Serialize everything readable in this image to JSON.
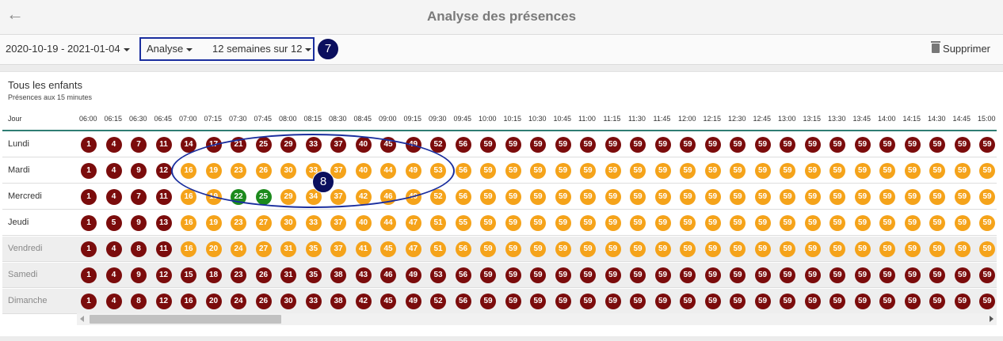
{
  "header": {
    "title": "Analyse des présences"
  },
  "toolbar": {
    "date_range": "2020-10-19 - 2021-01-04",
    "mode": "Analyse",
    "weeks": "12 semaines sur 12",
    "delete_label": "Supprimer"
  },
  "callouts": {
    "toolbar": "7",
    "grid": "8"
  },
  "panel": {
    "title": "Tous les enfants",
    "subtitle": "Présences aux 15 minutes"
  },
  "grid": {
    "first_column_header": "Jour",
    "times": [
      "06:00",
      "06:15",
      "06:30",
      "06:45",
      "07:00",
      "07:15",
      "07:30",
      "07:45",
      "08:00",
      "08:15",
      "08:30",
      "08:45",
      "09:00",
      "09:15",
      "09:30",
      "09:45",
      "10:00",
      "10:15",
      "10:30",
      "10:45",
      "11:00",
      "11:15",
      "11:30",
      "11:45",
      "12:00",
      "12:15",
      "12:30",
      "12:45",
      "13:00",
      "13:15",
      "13:30",
      "13:45",
      "14:00",
      "14:15",
      "14:30",
      "14:45",
      "15:00"
    ],
    "rows": [
      {
        "day": "Lundi",
        "shaded": false,
        "values": [
          1,
          4,
          7,
          11,
          14,
          17,
          21,
          25,
          29,
          33,
          37,
          40,
          45,
          49,
          52,
          56,
          59,
          59,
          59,
          59,
          59,
          59,
          59,
          59,
          59,
          59,
          59,
          59,
          59,
          59,
          59,
          59,
          59,
          59,
          59,
          59,
          59
        ],
        "colors": [
          "r",
          "r",
          "r",
          "r",
          "r",
          "r",
          "r",
          "r",
          "r",
          "r",
          "r",
          "r",
          "r",
          "r",
          "r",
          "r",
          "r",
          "r",
          "r",
          "r",
          "r",
          "r",
          "r",
          "r",
          "r",
          "r",
          "r",
          "r",
          "r",
          "r",
          "r",
          "r",
          "r",
          "r",
          "r",
          "r",
          "r"
        ]
      },
      {
        "day": "Mardi",
        "shaded": false,
        "values": [
          1,
          4,
          9,
          12,
          16,
          19,
          23,
          26,
          30,
          33,
          37,
          40,
          44,
          49,
          53,
          56,
          59,
          59,
          59,
          59,
          59,
          59,
          59,
          59,
          59,
          59,
          59,
          59,
          59,
          59,
          59,
          59,
          59,
          59,
          59,
          59,
          59
        ],
        "colors": [
          "r",
          "r",
          "r",
          "r",
          "o",
          "o",
          "o",
          "o",
          "o",
          "o",
          "o",
          "o",
          "o",
          "o",
          "o",
          "o",
          "o",
          "o",
          "o",
          "o",
          "o",
          "o",
          "o",
          "o",
          "o",
          "o",
          "o",
          "o",
          "o",
          "o",
          "o",
          "o",
          "o",
          "o",
          "o",
          "o",
          "o"
        ]
      },
      {
        "day": "Mercredi",
        "shaded": false,
        "values": [
          1,
          4,
          7,
          11,
          16,
          19,
          22,
          25,
          29,
          34,
          37,
          42,
          46,
          49,
          52,
          56,
          59,
          59,
          59,
          59,
          59,
          59,
          59,
          59,
          59,
          59,
          59,
          59,
          59,
          59,
          59,
          59,
          59,
          59,
          59,
          59,
          59
        ],
        "colors": [
          "r",
          "r",
          "r",
          "r",
          "o",
          "o",
          "g",
          "g",
          "o",
          "o",
          "o",
          "o",
          "o",
          "o",
          "o",
          "o",
          "o",
          "o",
          "o",
          "o",
          "o",
          "o",
          "o",
          "o",
          "o",
          "o",
          "o",
          "o",
          "o",
          "o",
          "o",
          "o",
          "o",
          "o",
          "o",
          "o",
          "o"
        ]
      },
      {
        "day": "Jeudi",
        "shaded": false,
        "values": [
          1,
          5,
          9,
          13,
          16,
          19,
          23,
          27,
          30,
          33,
          37,
          40,
          44,
          47,
          51,
          55,
          59,
          59,
          59,
          59,
          59,
          59,
          59,
          59,
          59,
          59,
          59,
          59,
          59,
          59,
          59,
          59,
          59,
          59,
          59,
          59,
          59
        ],
        "colors": [
          "r",
          "r",
          "r",
          "r",
          "o",
          "o",
          "o",
          "o",
          "o",
          "o",
          "o",
          "o",
          "o",
          "o",
          "o",
          "o",
          "o",
          "o",
          "o",
          "o",
          "o",
          "o",
          "o",
          "o",
          "o",
          "o",
          "o",
          "o",
          "o",
          "o",
          "o",
          "o",
          "o",
          "o",
          "o",
          "o",
          "o"
        ]
      },
      {
        "day": "Vendredi",
        "shaded": true,
        "values": [
          1,
          4,
          8,
          11,
          16,
          20,
          24,
          27,
          31,
          35,
          37,
          41,
          45,
          47,
          51,
          56,
          59,
          59,
          59,
          59,
          59,
          59,
          59,
          59,
          59,
          59,
          59,
          59,
          59,
          59,
          59,
          59,
          59,
          59,
          59,
          59,
          59
        ],
        "colors": [
          "r",
          "r",
          "r",
          "r",
          "o",
          "o",
          "o",
          "o",
          "o",
          "o",
          "o",
          "o",
          "o",
          "o",
          "o",
          "o",
          "o",
          "o",
          "o",
          "o",
          "o",
          "o",
          "o",
          "o",
          "o",
          "o",
          "o",
          "o",
          "o",
          "o",
          "o",
          "o",
          "o",
          "o",
          "o",
          "o",
          "o"
        ]
      },
      {
        "day": "Samedi",
        "shaded": true,
        "values": [
          1,
          4,
          9,
          12,
          15,
          18,
          23,
          26,
          31,
          35,
          38,
          43,
          46,
          49,
          53,
          56,
          59,
          59,
          59,
          59,
          59,
          59,
          59,
          59,
          59,
          59,
          59,
          59,
          59,
          59,
          59,
          59,
          59,
          59,
          59,
          59,
          59
        ],
        "colors": [
          "r",
          "r",
          "r",
          "r",
          "r",
          "r",
          "r",
          "r",
          "r",
          "r",
          "r",
          "r",
          "r",
          "r",
          "r",
          "r",
          "r",
          "r",
          "r",
          "r",
          "r",
          "r",
          "r",
          "r",
          "r",
          "r",
          "r",
          "r",
          "r",
          "r",
          "r",
          "r",
          "r",
          "r",
          "r",
          "r",
          "r"
        ]
      },
      {
        "day": "Dimanche",
        "shaded": true,
        "values": [
          1,
          4,
          8,
          12,
          16,
          20,
          24,
          26,
          30,
          33,
          38,
          42,
          45,
          49,
          52,
          56,
          59,
          59,
          59,
          59,
          59,
          59,
          59,
          59,
          59,
          59,
          59,
          59,
          59,
          59,
          59,
          59,
          59,
          59,
          59,
          59,
          59
        ],
        "colors": [
          "r",
          "r",
          "r",
          "r",
          "r",
          "r",
          "r",
          "r",
          "r",
          "r",
          "r",
          "r",
          "r",
          "r",
          "r",
          "r",
          "r",
          "r",
          "r",
          "r",
          "r",
          "r",
          "r",
          "r",
          "r",
          "r",
          "r",
          "r",
          "r",
          "r",
          "r",
          "r",
          "r",
          "r",
          "r",
          "r",
          "r"
        ]
      }
    ]
  },
  "colors": {
    "r": "#7b0c0c",
    "o": "#f5a31a",
    "g": "#1c8a1c",
    "accent": "#1a2e9e",
    "callout": "#0b0f5e"
  },
  "icons": {
    "back": "arrow-left-icon",
    "delete": "trash-icon"
  }
}
